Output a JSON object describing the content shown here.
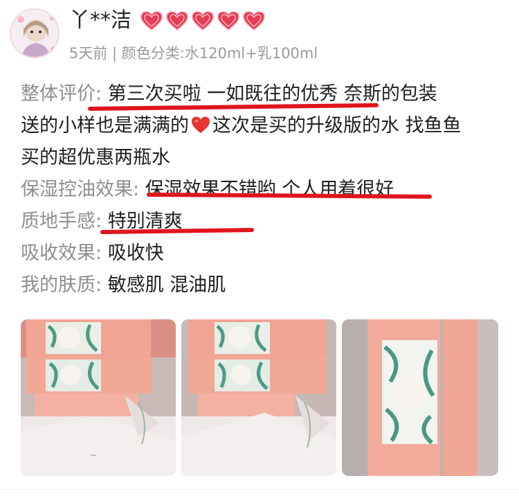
{
  "user": {
    "name": "丫**洁",
    "level_hearts": 5,
    "heart_color": "#e93b54",
    "meta": "5天前 | 颜色分类:水120ml+乳100ml"
  },
  "review": {
    "overall": {
      "label": "整体评价:",
      "line1": "第三次买啦 一如既往的优秀 奈斯的包装",
      "line2a": "送的小样也是满满的",
      "line2b": "这次是买的升级版的水 找鱼鱼",
      "line3": "买的超优惠两瓶水"
    },
    "moisture": {
      "label": "保湿控油效果:",
      "value": "保湿效果不错哟 个人用着很好"
    },
    "texture": {
      "label": "质地手感:",
      "value": "特别清爽"
    },
    "absorption": {
      "label": "吸收效果:",
      "value": "吸收快"
    },
    "skin_type": {
      "label": "我的肤质:",
      "value": "敏感肌 混油肌"
    },
    "highlight_color": "#e1141e"
  },
  "photos": [
    {
      "name": "photo-1"
    },
    {
      "name": "photo-2"
    },
    {
      "name": "photo-3"
    }
  ]
}
